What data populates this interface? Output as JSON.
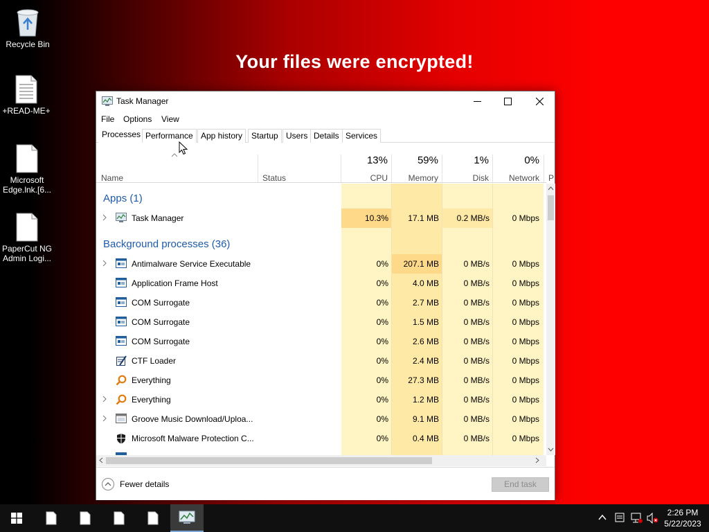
{
  "desktop": {
    "headline": "Your files were encrypted!",
    "icons": [
      {
        "label": "Recycle Bin",
        "icon": "recycle-bin-icon"
      },
      {
        "label": "+READ-ME+",
        "icon": "text-file-icon"
      },
      {
        "label": "Microsoft\nEdge.lnk.[6...",
        "icon": "file-icon"
      },
      {
        "label": "PaperCut NG\nAdmin Logi...",
        "icon": "file-icon"
      }
    ]
  },
  "window": {
    "title": "Task Manager",
    "menu": [
      "File",
      "Options",
      "View"
    ],
    "tabs": [
      "Processes",
      "Performance",
      "App history",
      "Startup",
      "Users",
      "Details",
      "Services"
    ],
    "active_tab": "Processes",
    "columns": {
      "name": "Name",
      "status": "Status",
      "cpu": {
        "label": "CPU",
        "pct": "13%"
      },
      "memory": {
        "label": "Memory",
        "pct": "59%"
      },
      "disk": {
        "label": "Disk",
        "pct": "1%"
      },
      "network": {
        "label": "Network",
        "pct": "0%"
      },
      "power_truncated": "P"
    },
    "groups": {
      "apps": "Apps (1)",
      "background": "Background processes (36)"
    },
    "apps": [
      {
        "name": "Task Manager",
        "cpu": "10.3%",
        "memory": "17.1 MB",
        "disk": "0.2 MB/s",
        "network": "0 Mbps",
        "expandable": true
      }
    ],
    "processes": [
      {
        "name": "Antimalware Service Executable",
        "cpu": "0%",
        "memory": "207.1 MB",
        "disk": "0 MB/s",
        "network": "0 Mbps",
        "expandable": true
      },
      {
        "name": "Application Frame Host",
        "cpu": "0%",
        "memory": "4.0 MB",
        "disk": "0 MB/s",
        "network": "0 Mbps",
        "expandable": false
      },
      {
        "name": "COM Surrogate",
        "cpu": "0%",
        "memory": "2.7 MB",
        "disk": "0 MB/s",
        "network": "0 Mbps",
        "expandable": false
      },
      {
        "name": "COM Surrogate",
        "cpu": "0%",
        "memory": "1.5 MB",
        "disk": "0 MB/s",
        "network": "0 Mbps",
        "expandable": false
      },
      {
        "name": "COM Surrogate",
        "cpu": "0%",
        "memory": "2.6 MB",
        "disk": "0 MB/s",
        "network": "0 Mbps",
        "expandable": false
      },
      {
        "name": "CTF Loader",
        "cpu": "0%",
        "memory": "2.4 MB",
        "disk": "0 MB/s",
        "network": "0 Mbps",
        "expandable": false
      },
      {
        "name": "Everything",
        "cpu": "0%",
        "memory": "27.3 MB",
        "disk": "0 MB/s",
        "network": "0 Mbps",
        "expandable": false
      },
      {
        "name": "Everything",
        "cpu": "0%",
        "memory": "1.2 MB",
        "disk": "0 MB/s",
        "network": "0 Mbps",
        "expandable": true
      },
      {
        "name": "Groove Music Download/Uploa...",
        "cpu": "0%",
        "memory": "9.1 MB",
        "disk": "0 MB/s",
        "network": "0 Mbps",
        "expandable": true
      },
      {
        "name": "Microsoft Malware Protection C...",
        "cpu": "0%",
        "memory": "0.4 MB",
        "disk": "0 MB/s",
        "network": "0 Mbps",
        "expandable": false
      }
    ],
    "footer": {
      "fewer_details": "Fewer details",
      "end_task": "End task"
    }
  },
  "taskbar": {
    "time": "2:26 PM",
    "date": "5/22/2023"
  },
  "colors": {
    "group_title": "#1e5ba8",
    "shade_light": "#fff4c4",
    "shade_medium": "#ffe9a6",
    "shade_strong": "#ffd98a",
    "desktop_red": "#ff0000"
  }
}
